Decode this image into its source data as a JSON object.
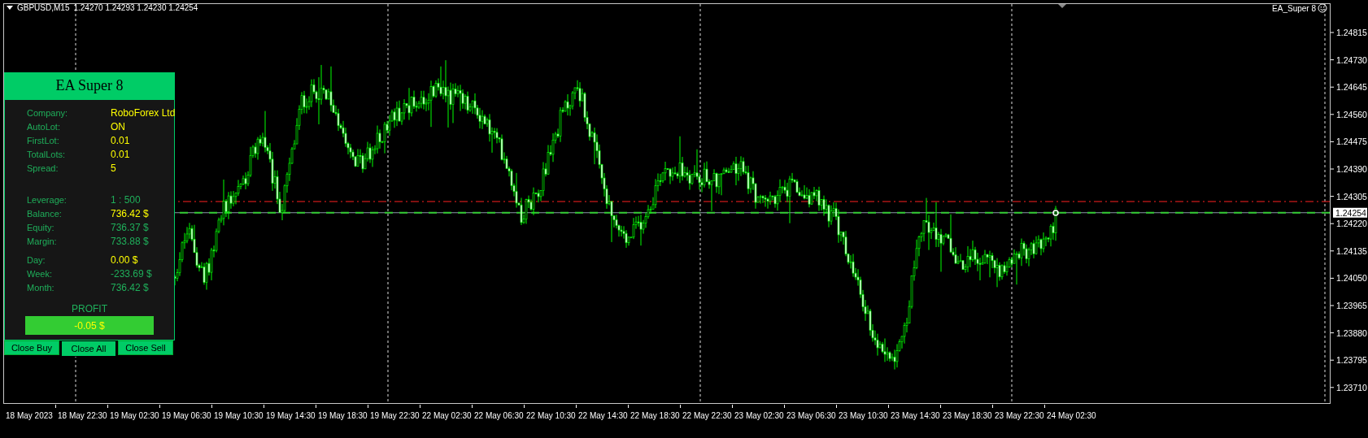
{
  "chart_header": {
    "symbol": "GBPUSD,M15",
    "ohlc": "1.24270 1.24293 1.24230 1.24254"
  },
  "expert_label": "EA_Super 8",
  "panel": {
    "title": "EA Super 8",
    "groups": [
      [
        {
          "label": "Company:",
          "value": "RoboForex Ltd",
          "color": "#ffff00"
        },
        {
          "label": "AutoLot:",
          "value": "ON",
          "color": "#ffff00"
        },
        {
          "label": "FirstLot:",
          "value": "0.01",
          "color": "#ffff00"
        },
        {
          "label": "TotalLots:",
          "value": "0.01",
          "color": "#ffff00"
        },
        {
          "label": "Spread:",
          "value": "5",
          "color": "#ffff00"
        }
      ],
      [
        {
          "label": "Leverage:",
          "value": "1 : 500",
          "color": "#1fae5a"
        },
        {
          "label": "Balance:",
          "value": "736.42 $",
          "color": "#ffff00"
        },
        {
          "label": "Equity:",
          "value": "736.37 $",
          "color": "#1fae5a"
        },
        {
          "label": "Margin:",
          "value": "733.88 $",
          "color": "#1fae5a"
        }
      ],
      [
        {
          "label": "Day:",
          "value": "0.00 $",
          "color": "#ffff00"
        },
        {
          "label": "Week:",
          "value": "-233.69 $",
          "color": "#1fae5a"
        },
        {
          "label": "Month:",
          "value": "736.42 $",
          "color": "#1fae5a"
        }
      ]
    ],
    "profit_label": "PROFIT",
    "profit_value": "-0.05 $",
    "buttons": [
      {
        "label": "Close Buy",
        "pressed": false
      },
      {
        "label": "Close All",
        "pressed": true
      },
      {
        "label": "Close Sell",
        "pressed": false
      }
    ]
  },
  "price_axis": {
    "ticks": [
      "1.24815",
      "1.24730",
      "1.24645",
      "1.24560",
      "1.24475",
      "1.24390",
      "1.24305",
      "1.24220",
      "1.24135",
      "1.24050",
      "1.23965",
      "1.23880",
      "1.23795",
      "1.23710"
    ],
    "current_price": "1.24254"
  },
  "time_axis": [
    "18 May 2023",
    "18 May 22:30",
    "19 May 02:30",
    "19 May 06:30",
    "19 May 10:30",
    "19 May 14:30",
    "19 May 18:30",
    "19 May 22:30",
    "22 May 02:30",
    "22 May 06:30",
    "22 May 10:30",
    "22 May 14:30",
    "22 May 18:30",
    "22 May 22:30",
    "23 May 02:30",
    "23 May 06:30",
    "23 May 10:30",
    "23 May 14:30",
    "23 May 18:30",
    "23 May 22:30",
    "24 May 02:30"
  ]
}
